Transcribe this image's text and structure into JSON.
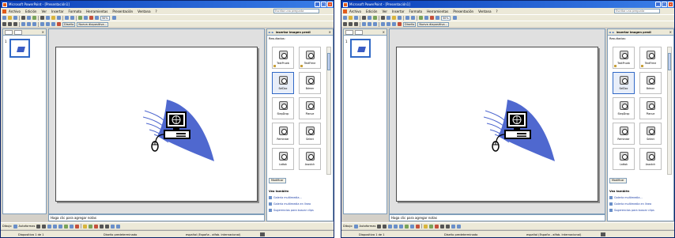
{
  "app": {
    "title": "Microsoft PowerPoint - [Presentación1]",
    "window_buttons": [
      "_",
      "□",
      "×"
    ]
  },
  "menu": [
    "Archivo",
    "Edición",
    "Ver",
    "Insertar",
    "Formato",
    "Herramientas",
    "Presentación",
    "Ventana",
    "?"
  ],
  "help_placeholder": "Escriba una pregunta",
  "toolbar": {
    "zoom": "50%",
    "design_label": "Diseño",
    "new_slide_label": "Nueva diapositiva..."
  },
  "thumbs": {
    "slide_number": "1"
  },
  "notes": {
    "placeholder": "Haga clic para agregar notas"
  },
  "panel": {
    "title": "Insertar imagen predi",
    "results_label": "Resultados:",
    "tiles": [
      {
        "label": "TextPrueb",
        "badge": true,
        "selected": false
      },
      {
        "label": "TextFrme",
        "badge": true,
        "selected": false
      },
      {
        "label": "SelDoc",
        "badge": false,
        "selected": true
      },
      {
        "label": "Bdmer",
        "badge": false,
        "selected": false
      },
      {
        "label": "StepDrop",
        "badge": false,
        "selected": false
      },
      {
        "label": "Planue",
        "badge": false,
        "selected": false
      },
      {
        "label": "Remindar",
        "badge": false,
        "selected": false
      },
      {
        "label": "Select",
        "badge": false,
        "selected": false
      },
      {
        "label": "Lattok",
        "badge": false,
        "selected": false
      },
      {
        "label": "Assvtch",
        "badge": false,
        "selected": false
      }
    ],
    "modify_label": "Modificar",
    "also_label": "Vea también",
    "links": [
      "Galería multimedia...",
      "Galería multimedia en línea",
      "Sugerencias para buscar clips"
    ]
  },
  "drawbar": {
    "draw_label": "Dibujo",
    "autoshapes_label": "Autoformas"
  },
  "status": {
    "slide": "Diapositiva 1 de 1",
    "design": "Diseño predeterminado",
    "language": "español (España - alfab. internacional)"
  }
}
